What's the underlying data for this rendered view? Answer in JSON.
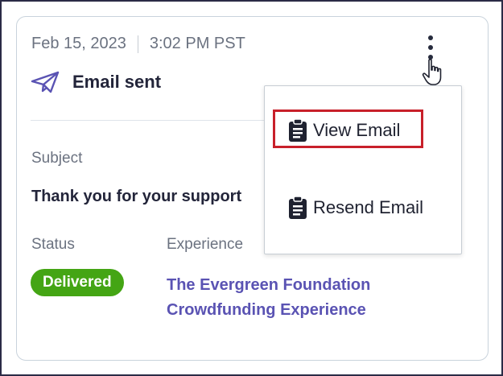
{
  "card": {
    "date": "Feb 15, 2023",
    "time": "3:02 PM PST",
    "event_label": "Email sent",
    "subject_label": "Subject",
    "subject_value": "Thank you for your support",
    "status_label": "Status",
    "status_value": "Delivered",
    "experience_label": "Experience",
    "experience_line1": "The Evergreen Foundation",
    "experience_line2": "Crowdfunding Experience"
  },
  "menu": {
    "items": [
      {
        "label": "View Email",
        "icon": "clipboard-icon"
      },
      {
        "label": "Resend Email",
        "icon": "clipboard-icon"
      }
    ]
  },
  "icons": {
    "event": "paper-plane-icon",
    "more": "kebab-menu-icon",
    "cursor": "hand-pointer-icon"
  },
  "colors": {
    "status_green": "#44a514",
    "link_purple": "#5a53b3",
    "highlight_red": "#c8202a",
    "text_dark": "#23253a",
    "text_muted": "#6b7280"
  }
}
